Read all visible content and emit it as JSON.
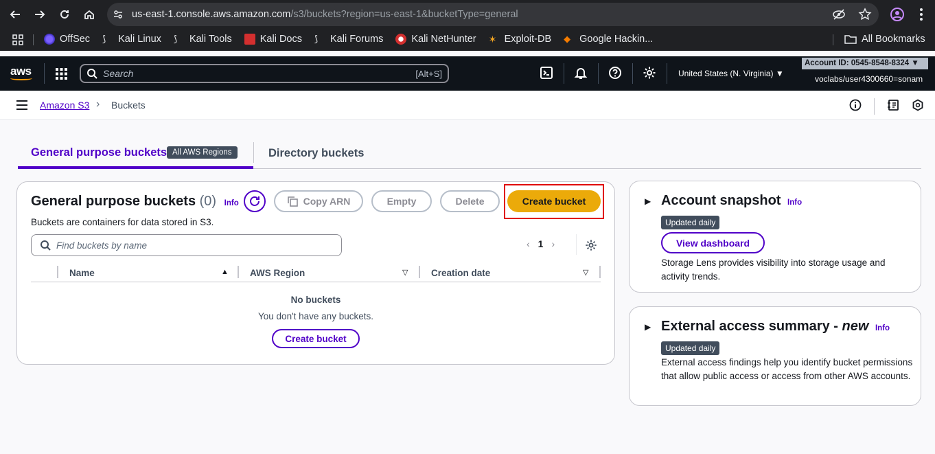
{
  "browser": {
    "url_host": "us-east-1.console.aws.amazon.com",
    "url_path": "/s3/buckets?region=us-east-1&bucketType=general",
    "bookmarks": [
      "OffSec",
      "Kali Linux",
      "Kali Tools",
      "Kali Docs",
      "Kali Forums",
      "Kali NetHunter",
      "Exploit-DB",
      "Google Hackin..."
    ],
    "all_bookmarks": "All Bookmarks"
  },
  "aws_nav": {
    "logo": "aws",
    "search_placeholder": "Search",
    "search_shortcut": "[Alt+S]",
    "region": "United States (N. Virginia)",
    "account_id": "Account ID: 0545-8548-8324",
    "user": "voclabs/user4300660=sonam"
  },
  "breadcrumb": {
    "service": "Amazon S3",
    "current": "Buckets"
  },
  "tabs": {
    "general": "General purpose buckets",
    "regions_badge": "All AWS Regions",
    "directory": "Directory buckets"
  },
  "buckets_panel": {
    "title": "General purpose buckets",
    "count": "(0)",
    "info": "Info",
    "subtitle": "Buckets are containers for data stored in S3.",
    "copy_arn": "Copy ARN",
    "empty": "Empty",
    "delete": "Delete",
    "create_bucket": "Create bucket",
    "search_placeholder": "Find buckets by name",
    "page": "1",
    "columns": [
      "Name",
      "AWS Region",
      "Creation date"
    ],
    "empty_title": "No buckets",
    "empty_sub": "You don't have any buckets.",
    "empty_create": "Create bucket"
  },
  "snapshot": {
    "title": "Account snapshot",
    "info": "Info",
    "badge": "Updated daily",
    "button": "View dashboard",
    "text": "Storage Lens provides visibility into storage usage and activity trends."
  },
  "external": {
    "title": "External access summary - ",
    "title_new": "new",
    "info": "Info",
    "badge": "Updated daily",
    "text": "External access findings help you identify bucket permissions that allow public access or access from other AWS accounts."
  }
}
